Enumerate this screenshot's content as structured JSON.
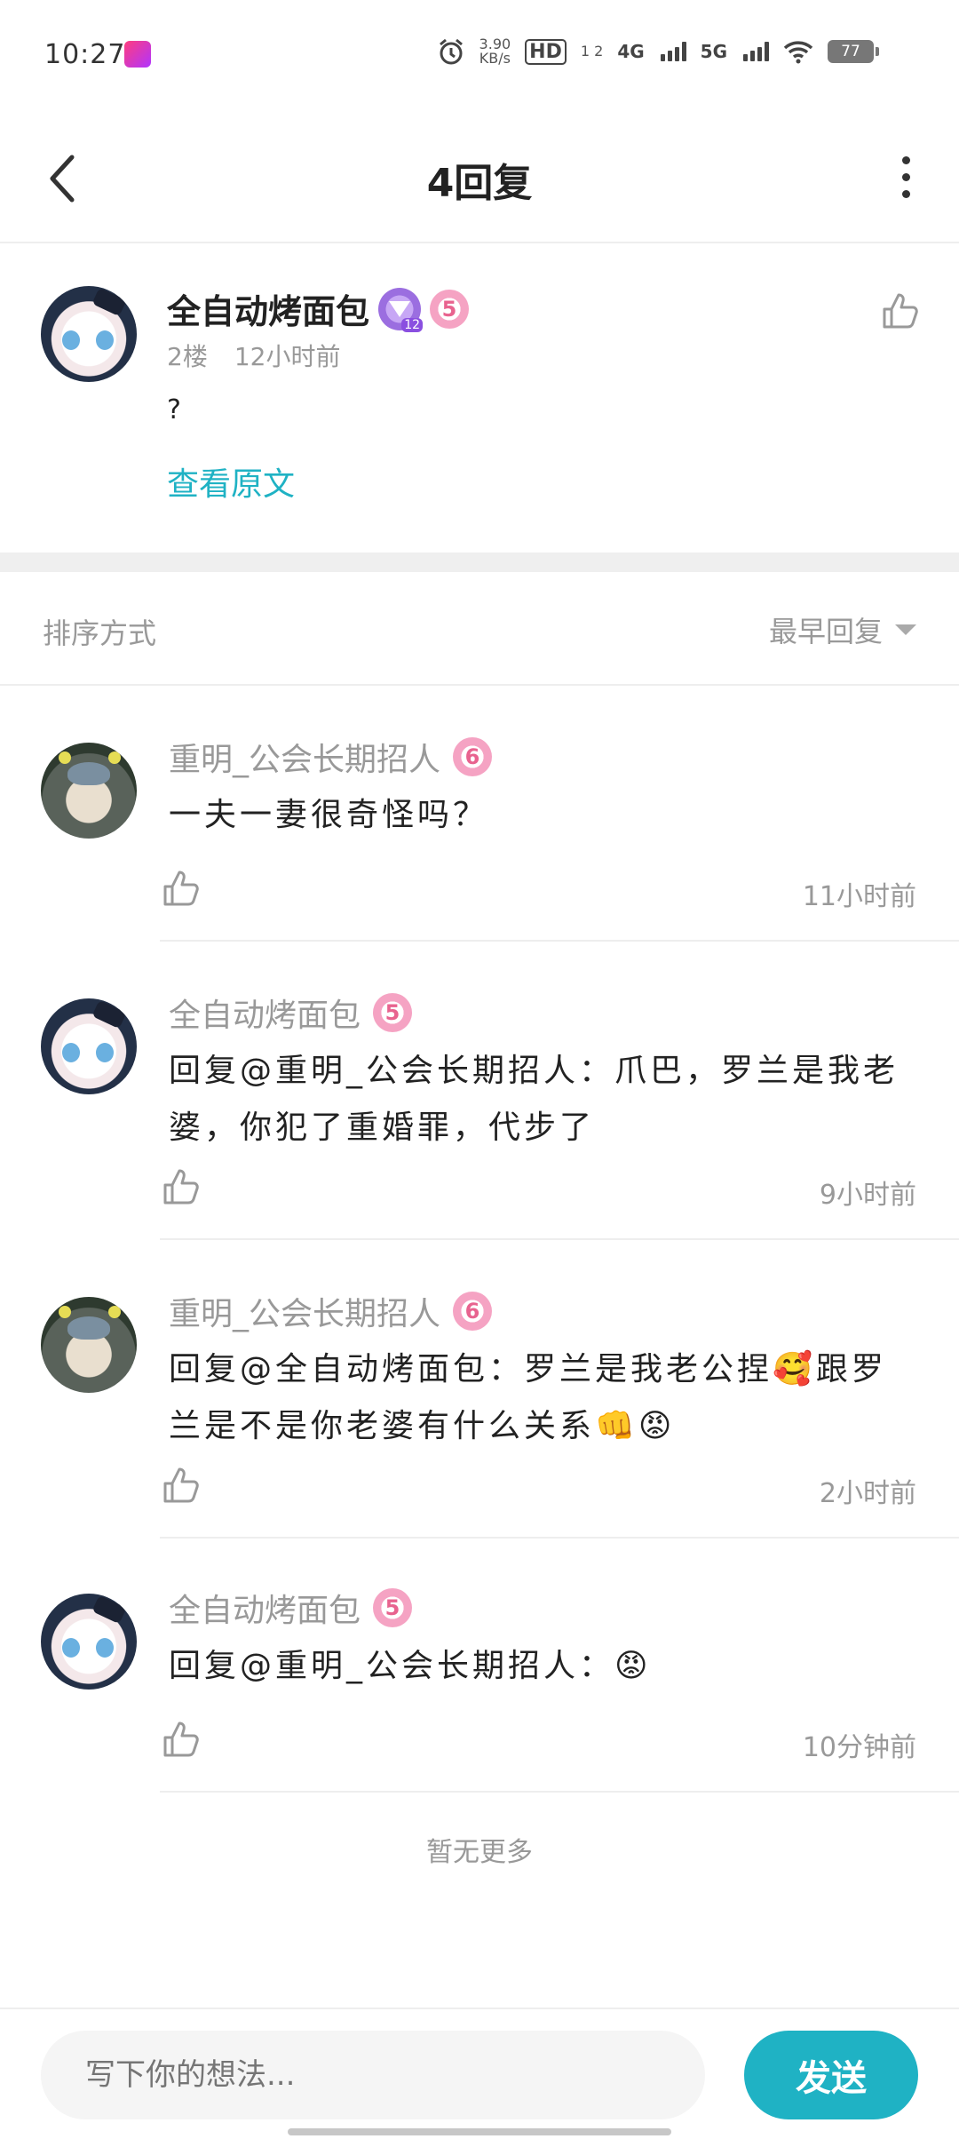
{
  "status_bar": {
    "time": "10:27",
    "speed": "3.90",
    "speed_unit": "KB/s",
    "hd": "HD",
    "hd_sub": "1 2",
    "net1": "4G",
    "net2": "5G",
    "battery": "77"
  },
  "header": {
    "title": "4回复"
  },
  "post": {
    "author": "全自动烤面包",
    "level_badge": "12",
    "pink_badge": "5",
    "floor": "2楼",
    "time": "12小时前",
    "content": "?",
    "view_original": "查看原文"
  },
  "sort": {
    "label": "排序方式",
    "selected": "最早回复"
  },
  "replies": [
    {
      "author": "重明_公会长期招人",
      "badge": "6",
      "text": "一夫一妻很奇怪吗？",
      "time": "11小时前"
    },
    {
      "author": "全自动烤面包",
      "badge": "5",
      "text": "回复@重明_公会长期招人：爪巴，罗兰是我老婆，你犯了重婚罪，代步了",
      "time": "9小时前"
    },
    {
      "author": "重明_公会长期招人",
      "badge": "6",
      "text": "回复@全自动烤面包：罗兰是我老公捏🥰跟罗兰是不是你老婆有什么关系👊😡",
      "time": "2小时前"
    },
    {
      "author": "全自动烤面包",
      "badge": "5",
      "text": "回复@重明_公会长期招人：😡",
      "time": "10分钟前"
    }
  ],
  "footer_note": "暂无更多",
  "composer": {
    "placeholder": "写下你的想法...",
    "send_label": "发送"
  },
  "colors": {
    "accent": "#1fb2c4",
    "muted": "#999999"
  }
}
